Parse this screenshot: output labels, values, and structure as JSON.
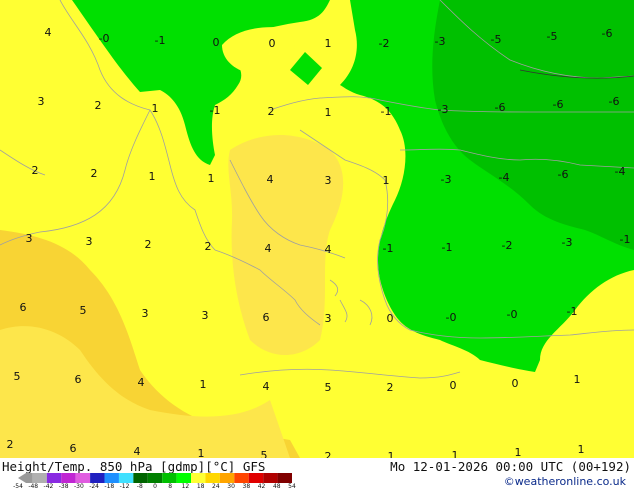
{
  "map": {
    "colors": {
      "yellow": "#ffff33",
      "orange_light": "#fde64b",
      "orange": "#f8d434",
      "green": "#00e000",
      "green_dark": "#00c000",
      "coast": "#a0a0a0",
      "label": "#111111"
    },
    "labels": [
      "4",
      "-0",
      "-1",
      "0",
      "0",
      "1",
      "-2",
      "-3",
      "-5",
      "-5",
      "-6",
      "3",
      "2",
      "1",
      "-1",
      "2",
      "1",
      "-1",
      "-3",
      "-6",
      "-6",
      "-6",
      "2",
      "2",
      "1",
      "1",
      "4",
      "3",
      "1",
      "-3",
      "-4",
      "-6",
      "-4",
      "3",
      "3",
      "2",
      "2",
      "4",
      "4",
      "-1",
      "-1",
      "-2",
      "-3",
      "-1",
      "6",
      "5",
      "3",
      "3",
      "6",
      "3",
      "0",
      "-0",
      "-0",
      "-1",
      "5",
      "6",
      "4",
      "1",
      "4",
      "5",
      "2",
      "0",
      "0",
      "1",
      "2",
      "6",
      "4",
      "1",
      "5",
      "2",
      "1",
      "1",
      "1",
      "1"
    ]
  },
  "footer": {
    "title_left": "Height/Temp. 850 hPa [gdmp][°C] GFS",
    "title_right": "Mo 12-01-2026 00:00 UTC (00+192)",
    "credit": "©weatheronline.co.uk",
    "colorbar": {
      "ticks": [
        "-54",
        "-48",
        "-42",
        "-38",
        "-30",
        "-24",
        "-18",
        "-12",
        "-8",
        "0",
        "8",
        "12",
        "18",
        "24",
        "30",
        "38",
        "42",
        "48",
        "54"
      ],
      "colors": [
        "#9a9a9a",
        "#b0b0b0",
        "#8a2be2",
        "#c026d3",
        "#e05ce0",
        "#2020c0",
        "#1e90ff",
        "#40e0ff",
        "#006400",
        "#008000",
        "#00c000",
        "#00ff00",
        "#ffff33",
        "#ffd700",
        "#ffa500",
        "#ff4500",
        "#e00000",
        "#b00000",
        "#800000"
      ]
    }
  }
}
